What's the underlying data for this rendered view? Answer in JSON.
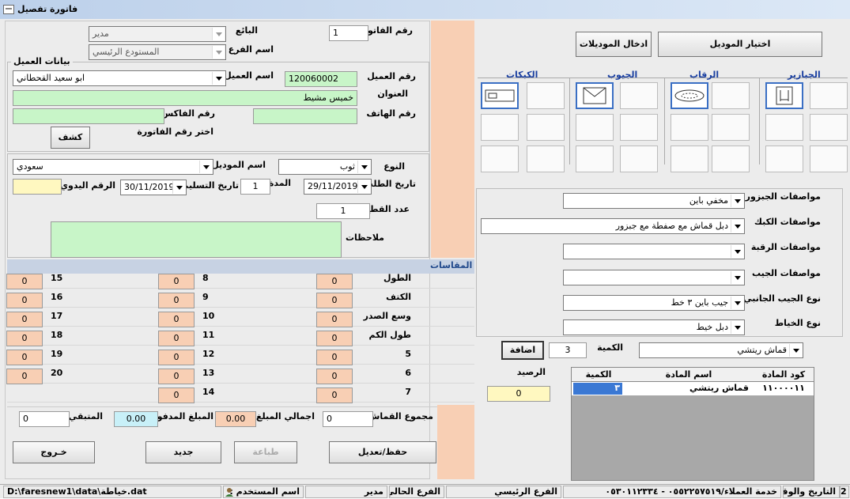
{
  "window": {
    "title": "فاتورة تفصيل"
  },
  "header": {
    "invoice_no_label": "رقم الفاتورة",
    "invoice_no": "1",
    "seller_label": "البائع",
    "seller": "مدير",
    "branch_label": "اسم الفرع",
    "branch": "المستودع الرئيسي"
  },
  "customer": {
    "group_label": "بيانات العميل",
    "number_label": "رقم العميل",
    "number": "120060002",
    "name_label": "اسم العميل",
    "name": "ابو سعيد القحطاني",
    "address_label": "العنوان",
    "address": "خميس مشيط",
    "phone_label": "رقم الهاتف",
    "phone": "",
    "fax_label": "رقم الفاكس",
    "fax": "",
    "choose_invoice_label": "اختر رقم الفاتورة",
    "search_button": "كشف"
  },
  "order": {
    "type_label": "النوع",
    "type": "ثوب",
    "model_label": "اسم الموديل",
    "model": "سعودي",
    "order_date_label": "تاريخ الطلب",
    "order_date": "29/11/2019",
    "duration_label": "المدة",
    "duration": "1",
    "delivery_label": "تاريخ التسليم",
    "delivery_date": "30/11/2019",
    "manual_label": "الرقم اليدوي",
    "manual": "",
    "pieces_label": "عدد القطع",
    "pieces": "1",
    "notes_label": "ملاحظات",
    "notes": ""
  },
  "measurements": {
    "title": "المقاسات",
    "col1": [
      {
        "label": "الطول",
        "value": "0"
      },
      {
        "label": "الكتف",
        "value": "0"
      },
      {
        "label": "وسع الصدر",
        "value": "0"
      },
      {
        "label": "طول الكم",
        "value": "0"
      },
      {
        "label": "5",
        "value": "0"
      },
      {
        "label": "6",
        "value": "0"
      },
      {
        "label": "7",
        "value": "0"
      }
    ],
    "col2": [
      {
        "label": "8",
        "value": "0"
      },
      {
        "label": "9",
        "value": "0"
      },
      {
        "label": "10",
        "value": "0"
      },
      {
        "label": "11",
        "value": "0"
      },
      {
        "label": "12",
        "value": "0"
      },
      {
        "label": "13",
        "value": "0"
      },
      {
        "label": "14",
        "value": "0"
      }
    ],
    "col3": [
      {
        "label": "15",
        "value": "0"
      },
      {
        "label": "16",
        "value": "0"
      },
      {
        "label": "17",
        "value": "0"
      },
      {
        "label": "18",
        "value": "0"
      },
      {
        "label": "19",
        "value": "0"
      },
      {
        "label": "20",
        "value": "0"
      }
    ]
  },
  "totals": {
    "fabric_total_label": "مجموع القماش",
    "fabric_total": "0",
    "amount_total_label": "اجمالي المبلغ",
    "amount_total": "0.00",
    "paid_label": "المبلغ المدفوع",
    "paid": "0.00",
    "remaining_label": "المتبقي",
    "remaining": "0"
  },
  "actions": {
    "save": "حفظ/تعديل",
    "print": "طباعة",
    "new": "جديد",
    "exit": "خـروج"
  },
  "models": {
    "choose_button": "اختيار الموديل",
    "enter_button": "ادخال الموديلات",
    "groups": [
      "الجبازير",
      "الرقاب",
      "الجيوب",
      "الكبكات"
    ]
  },
  "specs": {
    "jabzoor_label": "مواصفات الجبزور",
    "jabzoor": "مخفي باين",
    "cuff_label": "مواصفات الكبك",
    "cuff": "دبل قماش مع صفطة مع جبزور",
    "collar_label": "مواصفات الرقبة",
    "collar": "",
    "pocket_label": "مواصفات الجيب",
    "pocket": "",
    "side_pocket_label": "نوع الجيب الجانبي",
    "side_pocket": "جيب باين ٣ خط",
    "stitch_label": "نوع الخياط",
    "stitch": "دبل خيط"
  },
  "fabric": {
    "item": "قماش ريتشي",
    "qty_label": "الكمية",
    "qty": "3",
    "add_button": "اضافة",
    "balance_label": "الرصيد",
    "balance": "0",
    "grid_headers": [
      "كود المادة",
      "اسم المادة",
      "الكمية"
    ],
    "grid_rows": [
      {
        "code": "١١٠٠٠٠١١",
        "name": "قماش ريتشي",
        "qty": "٣"
      }
    ]
  },
  "status": {
    "datetime_label": "التاريخ والوقت",
    "datetime_value": "2",
    "service": "خدمة العملاء/٠٥٥٢٢٥٧٥١٩ - ٠٥٣٠١١٢٣٣٤",
    "branch": "الفرع الرئيسي",
    "current_branch_label": "الفرع الحالي",
    "user": "مدير",
    "user_label": "اسم المستخدم :",
    "path": "D:\\faresnew1\\data\\خياطة.dat"
  }
}
